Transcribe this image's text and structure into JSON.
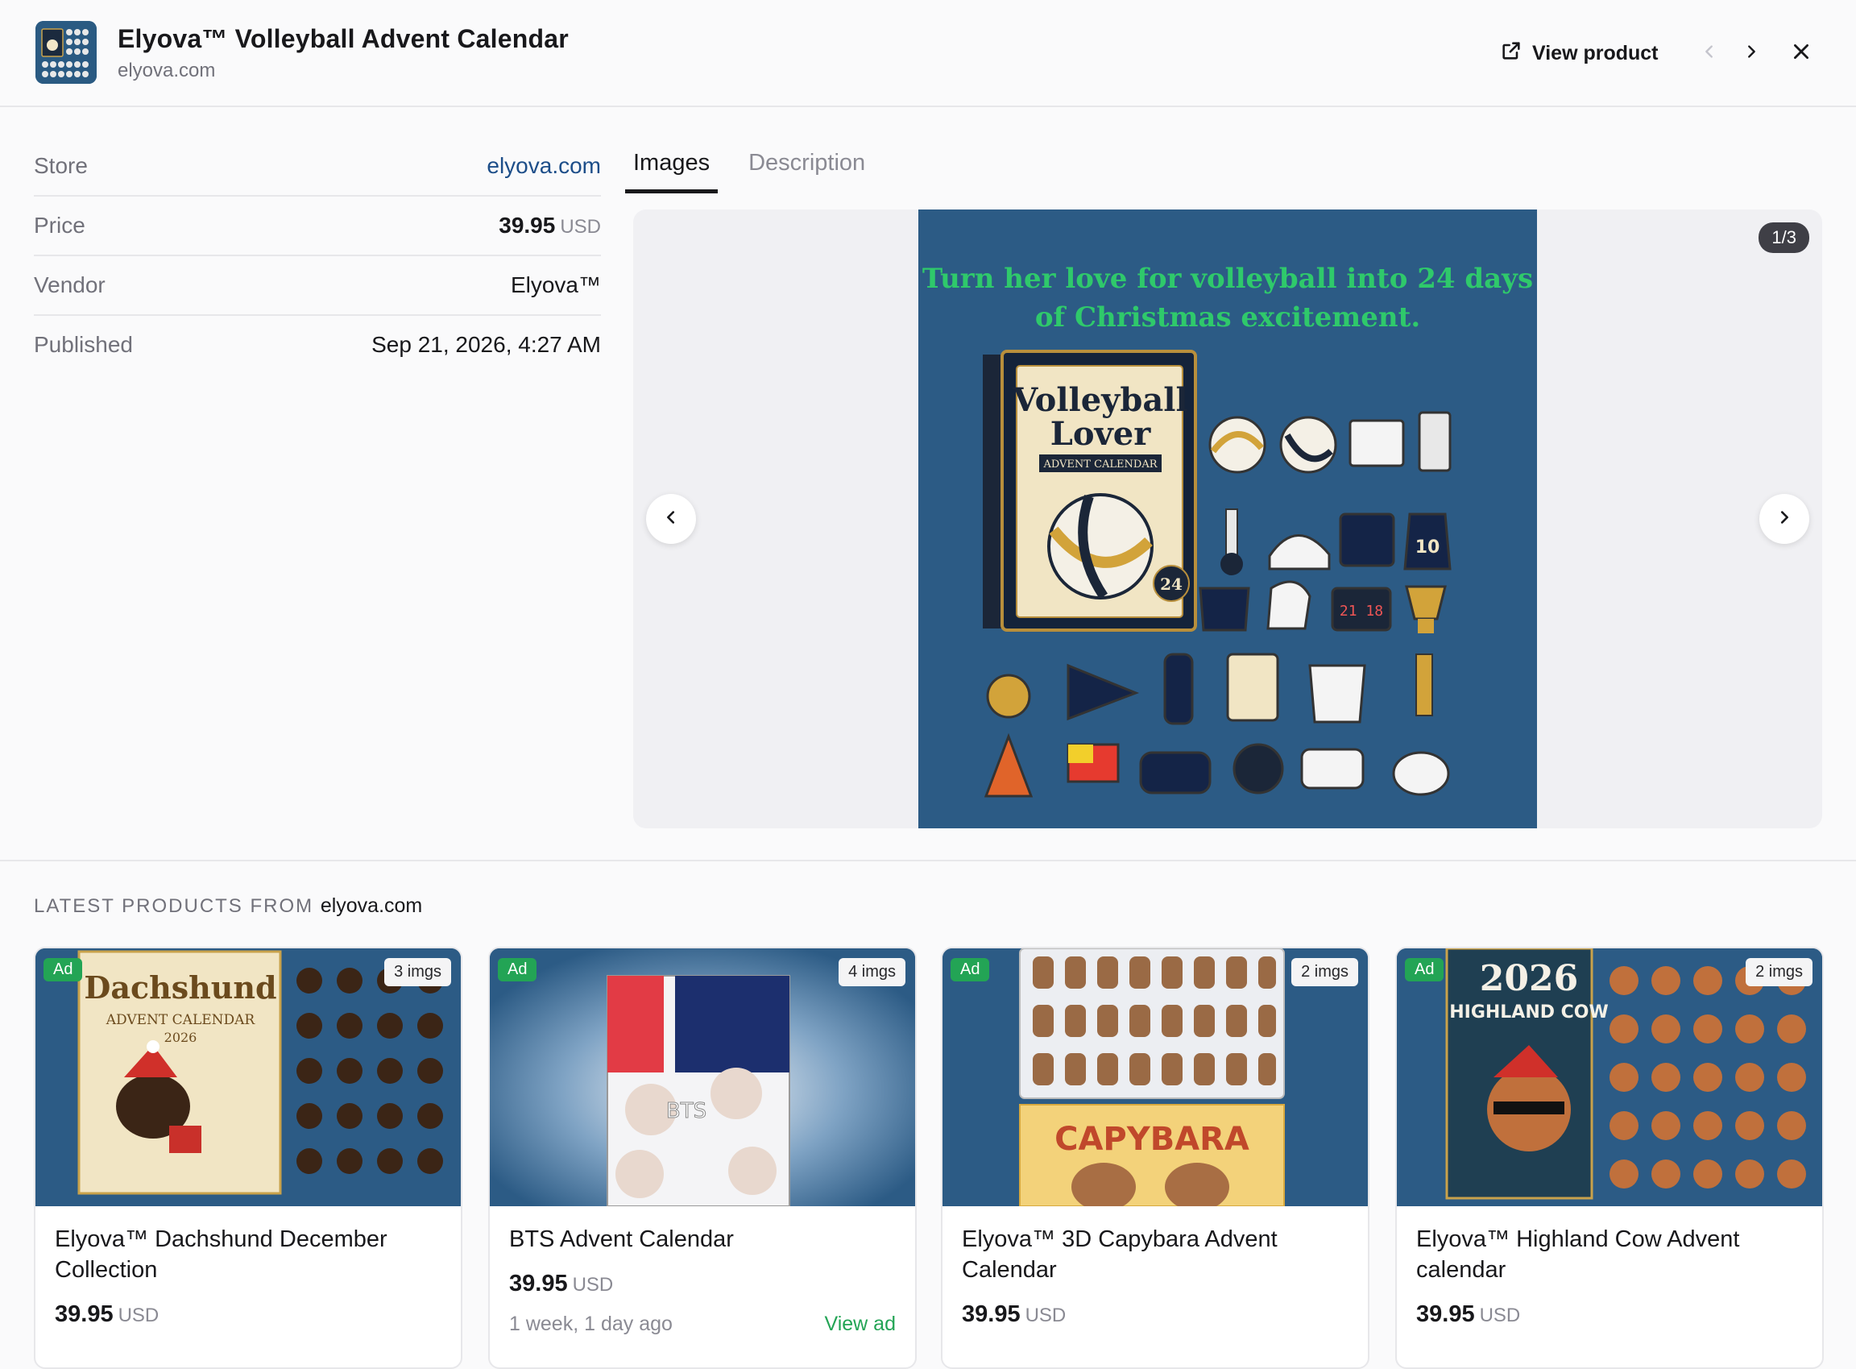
{
  "header": {
    "title": "Elyova™ Volleyball Advent Calendar",
    "subtitle": "elyova.com",
    "view_product": "View product"
  },
  "details": [
    {
      "label": "Store",
      "value": "elyova.com"
    },
    {
      "label": "Price",
      "value": "39.95",
      "currency": "USD"
    },
    {
      "label": "Vendor",
      "value": "Elyova™"
    },
    {
      "label": "Published",
      "value": "Sep 21, 2026, 4:27 AM"
    }
  ],
  "tabs": [
    {
      "label": "Images",
      "active": true
    },
    {
      "label": "Description",
      "active": false
    }
  ],
  "gallery": {
    "counter": "1/3",
    "headline_line1": "Turn her love for volleyball into 24 days",
    "headline_line2": "of Christmas excitement.",
    "box_title": "Volleyball Lover",
    "box_subtitle": "ADVENT CALENDAR",
    "box_count": "24"
  },
  "latest": {
    "prefix": "LATEST PRODUCTS FROM",
    "store": "elyova.com",
    "cards": [
      {
        "ad": "Ad",
        "imgs": "3 imgs",
        "title": "Elyova™ Dachshund December Collection",
        "price": "39.95",
        "currency": "USD",
        "image_text": "Dachshund",
        "image_sub": "ADVENT CALENDAR 2026"
      },
      {
        "ad": "Ad",
        "imgs": "4 imgs",
        "title": "BTS Advent Calendar",
        "price": "39.95",
        "currency": "USD",
        "time": "1 week, 1 day ago",
        "link": "View ad",
        "image_text": "BTS"
      },
      {
        "ad": "Ad",
        "imgs": "2 imgs",
        "title": "Elyova™ 3D Capybara Advent Calendar",
        "price": "39.95",
        "currency": "USD",
        "image_text": "CAPYBARA"
      },
      {
        "ad": "Ad",
        "imgs": "2 imgs",
        "title": "Elyova™ Highland Cow Advent calendar",
        "price": "39.95",
        "currency": "USD",
        "image_text": "2026",
        "image_sub": "HIGHLAND COW"
      }
    ]
  },
  "colors": {
    "accent_link": "#1d4e89",
    "ad_green": "#23a455",
    "headline_green": "#2fc96b",
    "image_bg": "#2c5b85"
  }
}
